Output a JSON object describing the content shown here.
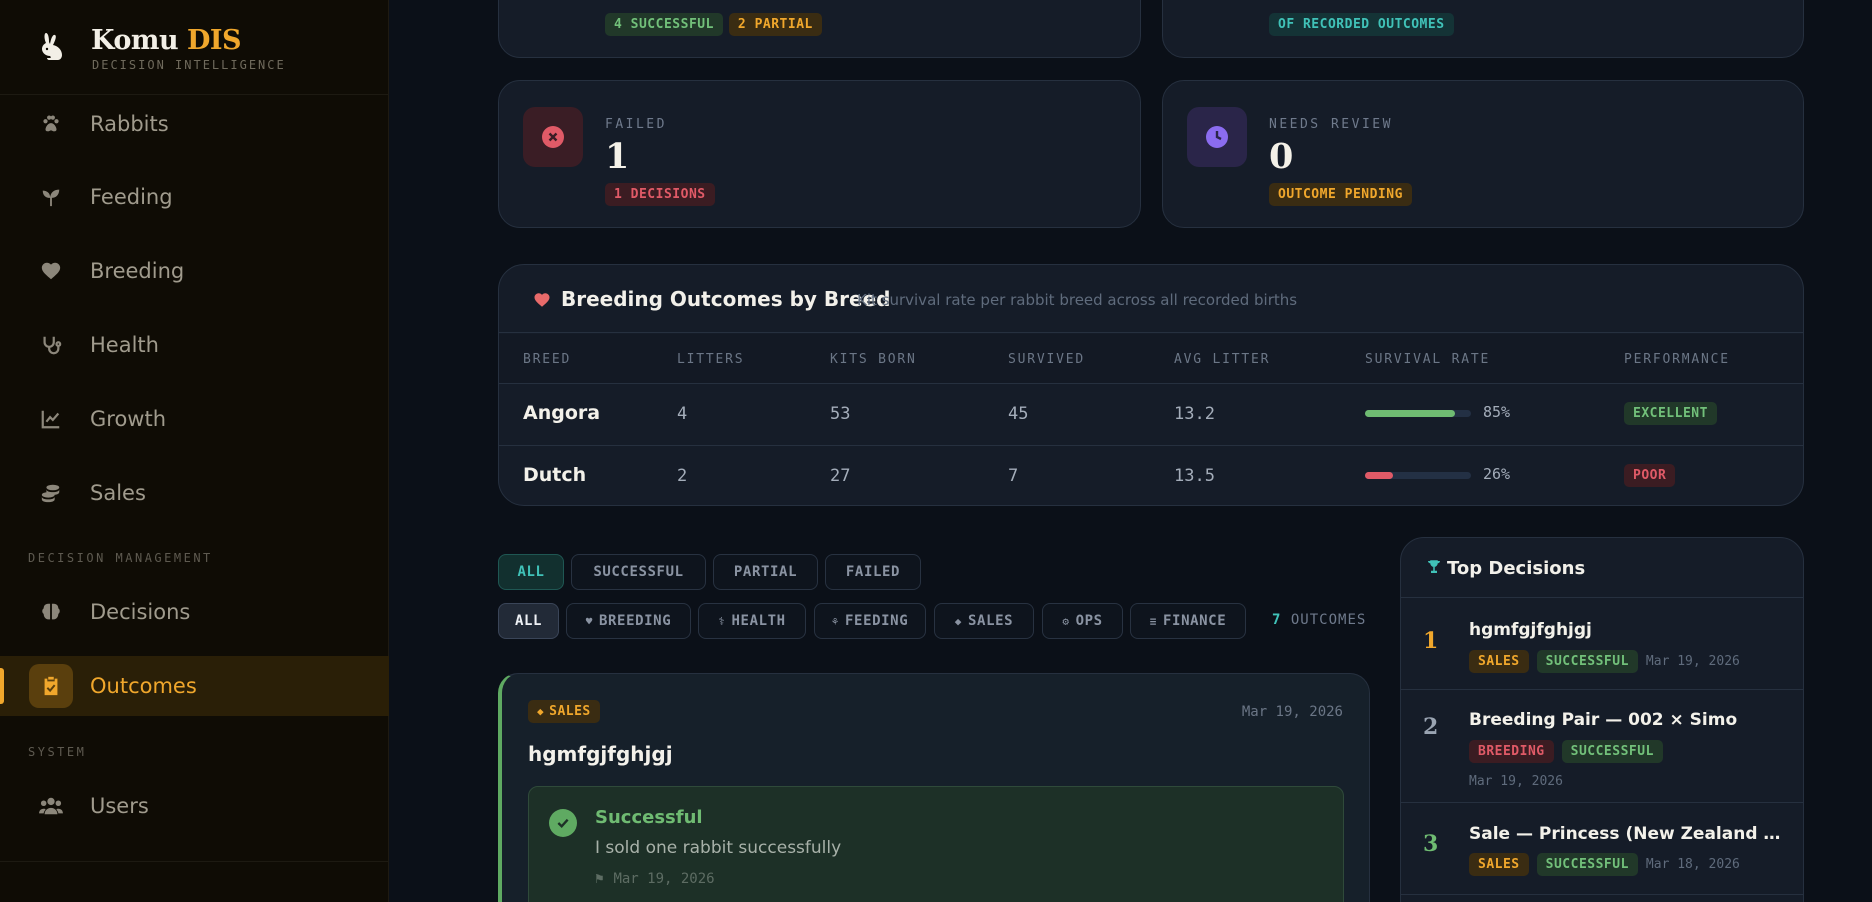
{
  "brand": {
    "name_main": "Komu ",
    "name_accent": "DIS",
    "subtitle": "DECISION INTELLIGENCE"
  },
  "nav": {
    "items": [
      {
        "label": "Rabbits",
        "icon": "paw-icon"
      },
      {
        "label": "Feeding",
        "icon": "sprout-icon"
      },
      {
        "label": "Breeding",
        "icon": "heart-icon"
      },
      {
        "label": "Health",
        "icon": "stethoscope-icon"
      },
      {
        "label": "Growth",
        "icon": "chart-line-icon"
      },
      {
        "label": "Sales",
        "icon": "coins-icon"
      }
    ],
    "section_decision": "DECISION MANAGEMENT",
    "decisions": "Decisions",
    "outcomes": "Outcomes",
    "section_system": "SYSTEM",
    "users": "Users"
  },
  "stats": {
    "successful_pill": "4 SUCCESSFUL",
    "partial_pill": "2 PARTIAL",
    "rate_pill": "OF RECORDED OUTCOMES",
    "failed": {
      "label": "FAILED",
      "value": "1",
      "pill": "1 DECISIONS"
    },
    "review": {
      "label": "NEEDS REVIEW",
      "value": "0",
      "pill": "OUTCOME PENDING"
    }
  },
  "breeding": {
    "title": "Breeding Outcomes by Breed",
    "subtitle": "Kit survival rate per rabbit breed across all recorded births",
    "headers": [
      "BREED",
      "LITTERS",
      "KITS BORN",
      "SURVIVED",
      "AVG LITTER",
      "SURVIVAL RATE",
      "PERFORMANCE"
    ],
    "rows": [
      {
        "breed": "Angora",
        "litters": "4",
        "kits": "53",
        "survived": "45",
        "avg": "13.2",
        "rate": 0.85,
        "rate_label": "85%",
        "perf": "EXCELLENT"
      },
      {
        "breed": "Dutch",
        "litters": "2",
        "kits": "27",
        "survived": "7",
        "avg": "13.5",
        "rate": 0.26,
        "rate_label": "26%",
        "perf": "POOR"
      }
    ]
  },
  "filters": {
    "status": [
      "ALL",
      "SUCCESSFUL",
      "PARTIAL",
      "FAILED"
    ],
    "category": [
      "ALL",
      "BREEDING",
      "HEALTH",
      "FEEDING",
      "SALES",
      "OPS",
      "FINANCE"
    ],
    "count": "7",
    "count_label": " OUTCOMES"
  },
  "decision_card": {
    "tag": "SALES",
    "date": "Mar 19, 2026",
    "title": "hgmfgjfghjgj",
    "outcome_title": "Successful",
    "outcome_text": "I sold one rabbit successfully",
    "outcome_date": "Mar 19, 2026"
  },
  "top_decisions": {
    "title": "Top Decisions",
    "items": [
      {
        "rank": "1",
        "name": "hgmfgjfghjgj",
        "category": "SALES",
        "status": "SUCCESSFUL",
        "date": "Mar 19, 2026"
      },
      {
        "rank": "2",
        "name": "Breeding Pair — 002 × Simo",
        "category": "BREEDING",
        "status": "SUCCESSFUL",
        "date": "Mar 19, 2026"
      },
      {
        "rank": "3",
        "name": "Sale — Princess (New Zealand White)",
        "category": "SALES",
        "status": "SUCCESSFUL",
        "date": "Mar 18, 2026"
      }
    ]
  },
  "colors": {
    "accent": "#f0a72c",
    "teal": "#40c2b8",
    "green": "#5faa62",
    "red": "#e05a67",
    "purple": "#8b6cf0"
  }
}
